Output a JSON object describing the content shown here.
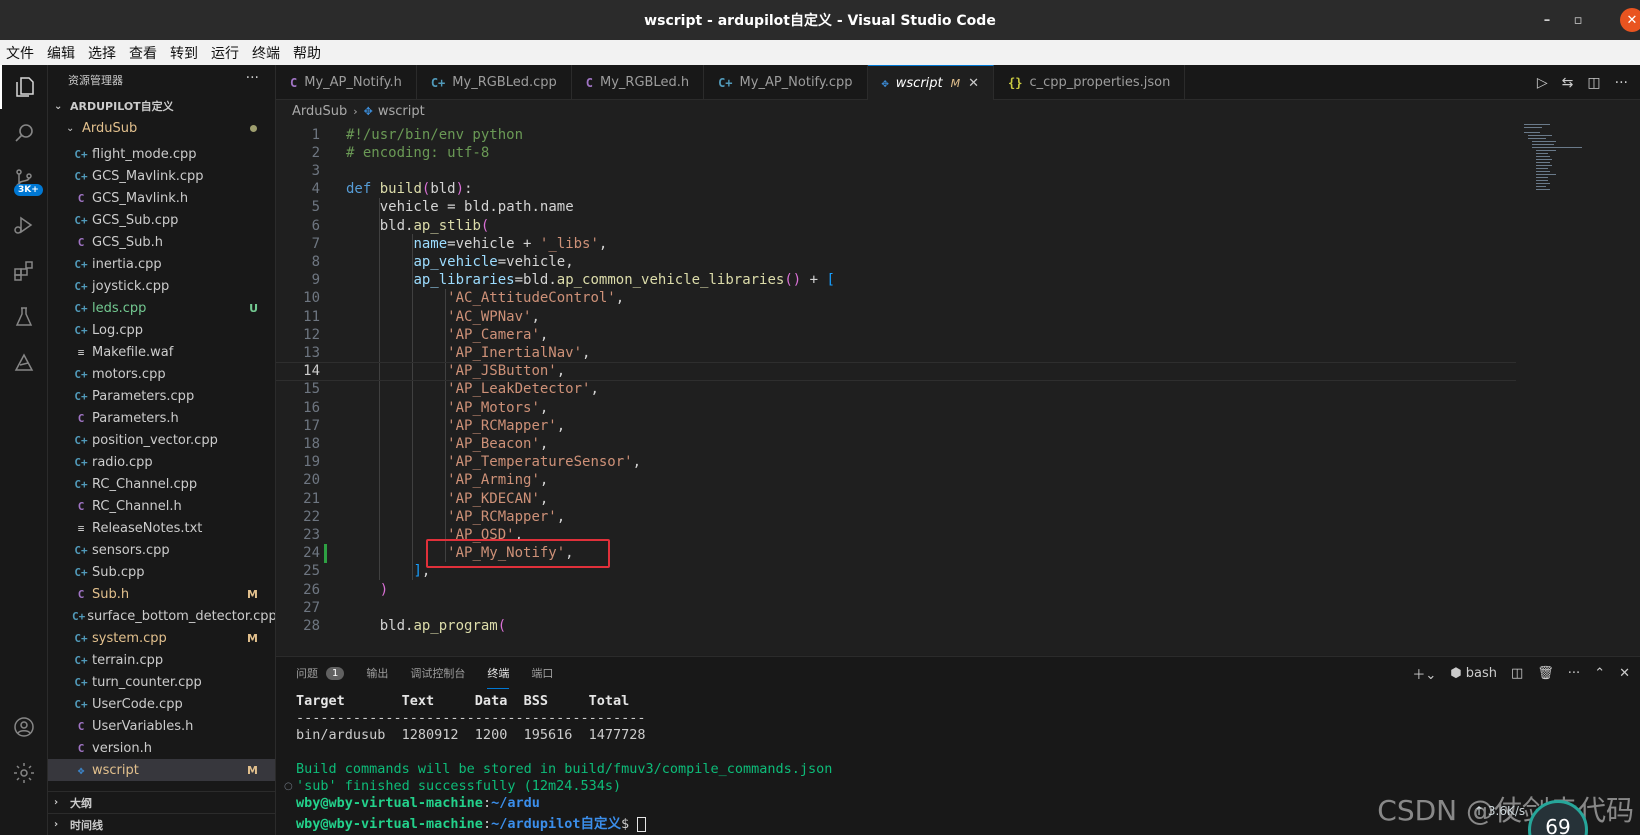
{
  "window": {
    "title": "wscript - ardupilot自定义 - Visual Studio Code"
  },
  "menu": [
    "文件",
    "编辑",
    "选择",
    "查看",
    "转到",
    "运行",
    "终端",
    "帮助"
  ],
  "activity": {
    "scm_badge": "3K+"
  },
  "explorer": {
    "title": "资源管理器",
    "root": "ARDUPILOT自定义",
    "folder": "ArduSub",
    "files": [
      {
        "name": "flight_mode.cpp",
        "icon": "cpp"
      },
      {
        "name": "GCS_Mavlink.cpp",
        "icon": "cpp"
      },
      {
        "name": "GCS_Mavlink.h",
        "icon": "h"
      },
      {
        "name": "GCS_Sub.cpp",
        "icon": "cpp"
      },
      {
        "name": "GCS_Sub.h",
        "icon": "h"
      },
      {
        "name": "inertia.cpp",
        "icon": "cpp"
      },
      {
        "name": "joystick.cpp",
        "icon": "cpp"
      },
      {
        "name": "leds.cpp",
        "icon": "cpp",
        "status": "U"
      },
      {
        "name": "Log.cpp",
        "icon": "cpp"
      },
      {
        "name": "Makefile.waf",
        "icon": "txt"
      },
      {
        "name": "motors.cpp",
        "icon": "cpp"
      },
      {
        "name": "Parameters.cpp",
        "icon": "cpp"
      },
      {
        "name": "Parameters.h",
        "icon": "h"
      },
      {
        "name": "position_vector.cpp",
        "icon": "cpp"
      },
      {
        "name": "radio.cpp",
        "icon": "cpp"
      },
      {
        "name": "RC_Channel.cpp",
        "icon": "cpp"
      },
      {
        "name": "RC_Channel.h",
        "icon": "h"
      },
      {
        "name": "ReleaseNotes.txt",
        "icon": "txt"
      },
      {
        "name": "sensors.cpp",
        "icon": "cpp"
      },
      {
        "name": "Sub.cpp",
        "icon": "cpp"
      },
      {
        "name": "Sub.h",
        "icon": "h",
        "status": "M"
      },
      {
        "name": "surface_bottom_detector.cpp",
        "icon": "cpp"
      },
      {
        "name": "system.cpp",
        "icon": "cpp",
        "status": "M"
      },
      {
        "name": "terrain.cpp",
        "icon": "cpp"
      },
      {
        "name": "turn_counter.cpp",
        "icon": "cpp"
      },
      {
        "name": "UserCode.cpp",
        "icon": "cpp"
      },
      {
        "name": "UserVariables.h",
        "icon": "h"
      },
      {
        "name": "version.h",
        "icon": "h"
      },
      {
        "name": "wscript",
        "icon": "py",
        "status": "M"
      }
    ],
    "outline": "大纲",
    "timeline": "时间线"
  },
  "tabs": [
    {
      "label": "My_AP_Notify.h",
      "icon": "h"
    },
    {
      "label": "My_RGBLed.cpp",
      "icon": "cpp"
    },
    {
      "label": "My_RGBLed.h",
      "icon": "h"
    },
    {
      "label": "My_AP_Notify.cpp",
      "icon": "cpp"
    },
    {
      "label": "wscript",
      "icon": "py",
      "modified": "M",
      "active": true
    },
    {
      "label": "c_cpp_properties.json",
      "icon": "json"
    }
  ],
  "breadcrumb": {
    "folder": "ArduSub",
    "file": "wscript"
  },
  "editor": {
    "current_line": 14,
    "lines": [
      {
        "n": "1",
        "t": "#!/usr/bin/env python"
      },
      {
        "n": "2",
        "t": "# encoding: utf-8"
      },
      {
        "n": "3",
        "t": ""
      },
      {
        "n": "4",
        "t": "def build(bld):"
      },
      {
        "n": "5",
        "t": "    vehicle = bld.path.name"
      },
      {
        "n": "6",
        "t": "    bld.ap_stlib("
      },
      {
        "n": "7",
        "t": "        name=vehicle + '_libs',"
      },
      {
        "n": "8",
        "t": "        ap_vehicle=vehicle,"
      },
      {
        "n": "9",
        "t": "        ap_libraries=bld.ap_common_vehicle_libraries() + ["
      },
      {
        "n": "10",
        "t": "            'AC_AttitudeControl',"
      },
      {
        "n": "11",
        "t": "            'AC_WPNav',"
      },
      {
        "n": "12",
        "t": "            'AP_Camera',"
      },
      {
        "n": "13",
        "t": "            'AP_InertialNav',"
      },
      {
        "n": "14",
        "t": "            'AP_JSButton',"
      },
      {
        "n": "15",
        "t": "            'AP_LeakDetector',"
      },
      {
        "n": "16",
        "t": "            'AP_Motors',"
      },
      {
        "n": "17",
        "t": "            'AP_RCMapper',"
      },
      {
        "n": "18",
        "t": "            'AP_Beacon',"
      },
      {
        "n": "19",
        "t": "            'AP_TemperatureSensor',"
      },
      {
        "n": "20",
        "t": "            'AP_Arming',"
      },
      {
        "n": "21",
        "t": "            'AP_KDECAN',"
      },
      {
        "n": "22",
        "t": "            'AP_RCMapper',"
      },
      {
        "n": "23",
        "t": "            'AP_OSD',"
      },
      {
        "n": "24",
        "t": "            'AP_My_Notify',"
      },
      {
        "n": "25",
        "t": "        ],"
      },
      {
        "n": "26",
        "t": "    )"
      },
      {
        "n": "27",
        "t": ""
      },
      {
        "n": "28",
        "t": "    bld.ap_program("
      }
    ]
  },
  "panel": {
    "tabs": [
      "问题",
      "输出",
      "调试控制台",
      "终端",
      "端口"
    ],
    "problems_count": "1",
    "shell": "bash",
    "terminal": {
      "header": "Target       Text     Data  BSS     Total",
      "divider": "-------------------------------------------",
      "row": "bin/ardusub  1280912  1200  195616  1477728",
      "build_line1": "Build commands will be stored in build/fmuv3/compile_commands.json",
      "build_line2": "'sub' finished successfully (12m24.534s)",
      "prompt1_user": "wby@wby-virtual-machine",
      "prompt1_path": "~/ardu",
      "prompt2_user": "wby@wby-virtual-machine",
      "prompt2_path": "~/ardupilot自定义",
      "prompt_symbol": "$"
    }
  },
  "overlay": {
    "watermark": "CSDN @仗剑走代码",
    "net_speed": "3.6K/s",
    "gauge": "69"
  }
}
